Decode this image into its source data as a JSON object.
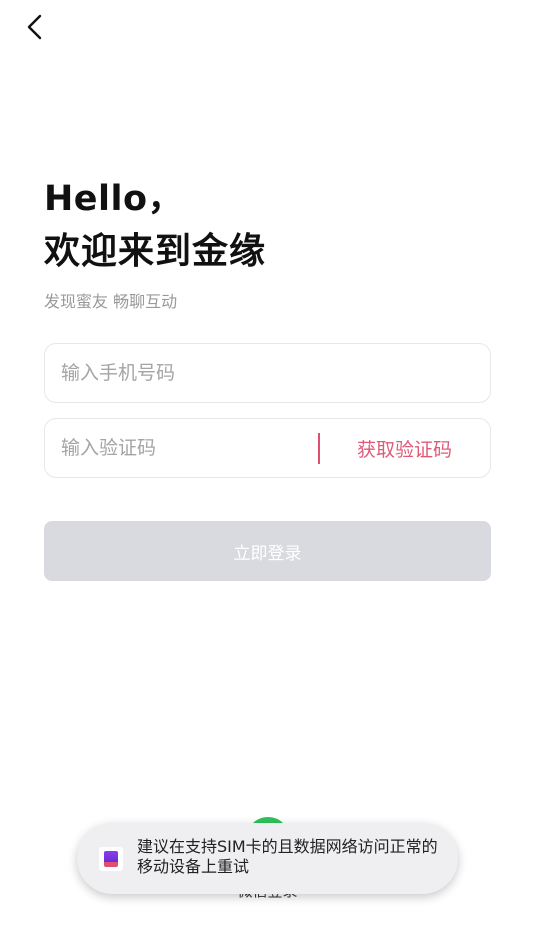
{
  "header": {
    "back_icon": "chevron-left-icon"
  },
  "welcome": {
    "hello": "Hello，",
    "title": "欢迎来到金缘",
    "subtitle": "发现蜜友 畅聊互动"
  },
  "form": {
    "phone_placeholder": "输入手机号码",
    "code_placeholder": "输入验证码",
    "get_code_label": "获取验证码",
    "login_label": "立即登录"
  },
  "alt_login": {
    "icon": "wechat-icon",
    "label": "微信登录",
    "color": "#2dc35b"
  },
  "toast": {
    "icon": "app-icon",
    "message": "建议在支持SIM卡的且数据网络访问正常的移动设备上重试"
  },
  "colors": {
    "accent": "#e05a78",
    "button_disabled": "#d8dadf"
  }
}
